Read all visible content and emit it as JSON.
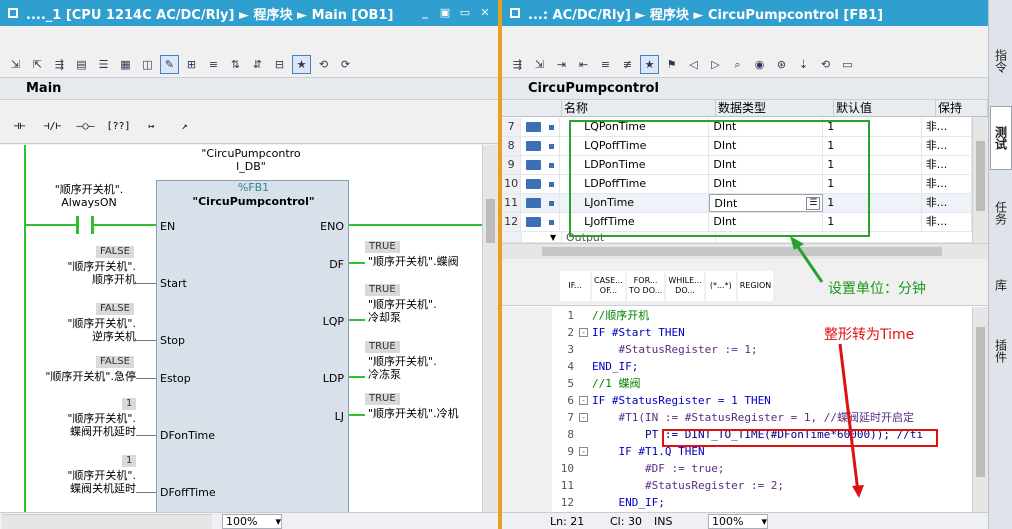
{
  "left": {
    "title": "...._1 [CPU 1214C AC/DC/Rly] ► 程序块 ► Main [OB1]",
    "block_name": "Main",
    "ladder_buttons": [
      "⊣⊢",
      "⊣/⊢",
      "–○–",
      "[??]",
      "↦",
      "↗"
    ],
    "fb_instance": "\"CircuPumpcontro\nl_DB\"",
    "fb_number": "%FB1",
    "fb_name": "\"CircuPumpcontrol\"",
    "contact_label": "\"顺序开关机\".\nAlwaysON",
    "pins_in": [
      "EN",
      "Start",
      "Stop",
      "Estop",
      "DFonTime",
      "DFoffTime"
    ],
    "pins_out": [
      "ENO",
      "DF",
      "LQP",
      "LDP",
      "LJ"
    ],
    "inputs": [
      {
        "value": "FALSE",
        "label": "\"顺序开关机\".\n顺序开机"
      },
      {
        "value": "FALSE",
        "label": "\"顺序开关机\".\n逆序关机"
      },
      {
        "value": "FALSE",
        "label": "\"顺序开关机\".急停"
      },
      {
        "value": "1",
        "label": "\"顺序开关机\".\n蝶阀开机延时"
      },
      {
        "value": "1",
        "label": "\"顺序开关机\".\n蝶阀关机延时"
      }
    ],
    "outputs": [
      {
        "value": "TRUE",
        "label": "\"顺序开关机\".蝶阀"
      },
      {
        "value": "TRUE",
        "label": "\"顺序开关机\".\n冷却泵"
      },
      {
        "value": "TRUE",
        "label": "\"顺序开关机\".\n冷冻泵"
      },
      {
        "value": "TRUE",
        "label": "\"顺序开关机\".冷机"
      }
    ],
    "zoom": "100%"
  },
  "right": {
    "title": "...: AC/DC/Rly] ► 程序块 ► CircuPumpcontrol [FB1]",
    "block_name": "CircuPumpcontrol",
    "columns": [
      "名称",
      "数据类型",
      "默认值",
      "保持"
    ],
    "rows": [
      {
        "num": "7",
        "name": "LQPonTime",
        "type": "DInt",
        "default": "1",
        "retain": "非..."
      },
      {
        "num": "8",
        "name": "LQPoffTime",
        "type": "DInt",
        "default": "1",
        "retain": "非..."
      },
      {
        "num": "9",
        "name": "LDPonTime",
        "type": "DInt",
        "default": "1",
        "retain": "非..."
      },
      {
        "num": "10",
        "name": "LDPoffTime",
        "type": "DInt",
        "default": "1",
        "retain": "非..."
      },
      {
        "num": "11",
        "name": "LJonTime",
        "type": "DInt",
        "default": "1",
        "retain": "非..."
      },
      {
        "num": "12",
        "name": "LJoffTime",
        "type": "DInt",
        "default": "1",
        "retain": "非..."
      }
    ],
    "output_row": "Output",
    "scl_buttons": [
      "IF...",
      "CASE...\nOF...",
      "FOR...\nTO DO...",
      "WHILE...\nDO...",
      "(*...*)",
      "REGION"
    ],
    "code": [
      {
        "n": "1",
        "fold": "",
        "text": "//顺序开机"
      },
      {
        "n": "2",
        "fold": "-",
        "text": "IF #Start THEN"
      },
      {
        "n": "3",
        "fold": "",
        "text": "    #StatusRegister := 1;"
      },
      {
        "n": "4",
        "fold": "",
        "text": "END_IF;"
      },
      {
        "n": "5",
        "fold": "",
        "text": "//1 蝶阀"
      },
      {
        "n": "6",
        "fold": "-",
        "text": "IF #StatusRegister = 1 THEN"
      },
      {
        "n": "7",
        "fold": "-",
        "text": "    #T1(IN := #StatusRegister = 1, //蝶阀延时开启定"
      },
      {
        "n": "8",
        "fold": "",
        "text": "        PT := DINT_TO_TIME(#DFonTime*60000)); //ti"
      },
      {
        "n": "9",
        "fold": "-",
        "text": "    IF #T1.Q THEN"
      },
      {
        "n": "10",
        "fold": "",
        "text": "        #DF := true;"
      },
      {
        "n": "11",
        "fold": "",
        "text": "        #StatusRegister := 2;"
      },
      {
        "n": "12",
        "fold": "",
        "text": "    END_IF;"
      }
    ],
    "status": {
      "ln": "Ln: 21",
      "cl": "Cl: 30",
      "mode": "INS",
      "zoom": "100%"
    },
    "annotation_unit": "设置单位：分钟",
    "annotation_time": "整形转为Time"
  },
  "side_tabs": [
    "指令",
    "测试",
    "任务",
    "库",
    "插件"
  ],
  "colors": {
    "title": "#2f9fd0",
    "splitter": "#e8a020",
    "power": "#2ec02e",
    "annot_green": "#2ca02c",
    "annot_red": "#e01010"
  }
}
